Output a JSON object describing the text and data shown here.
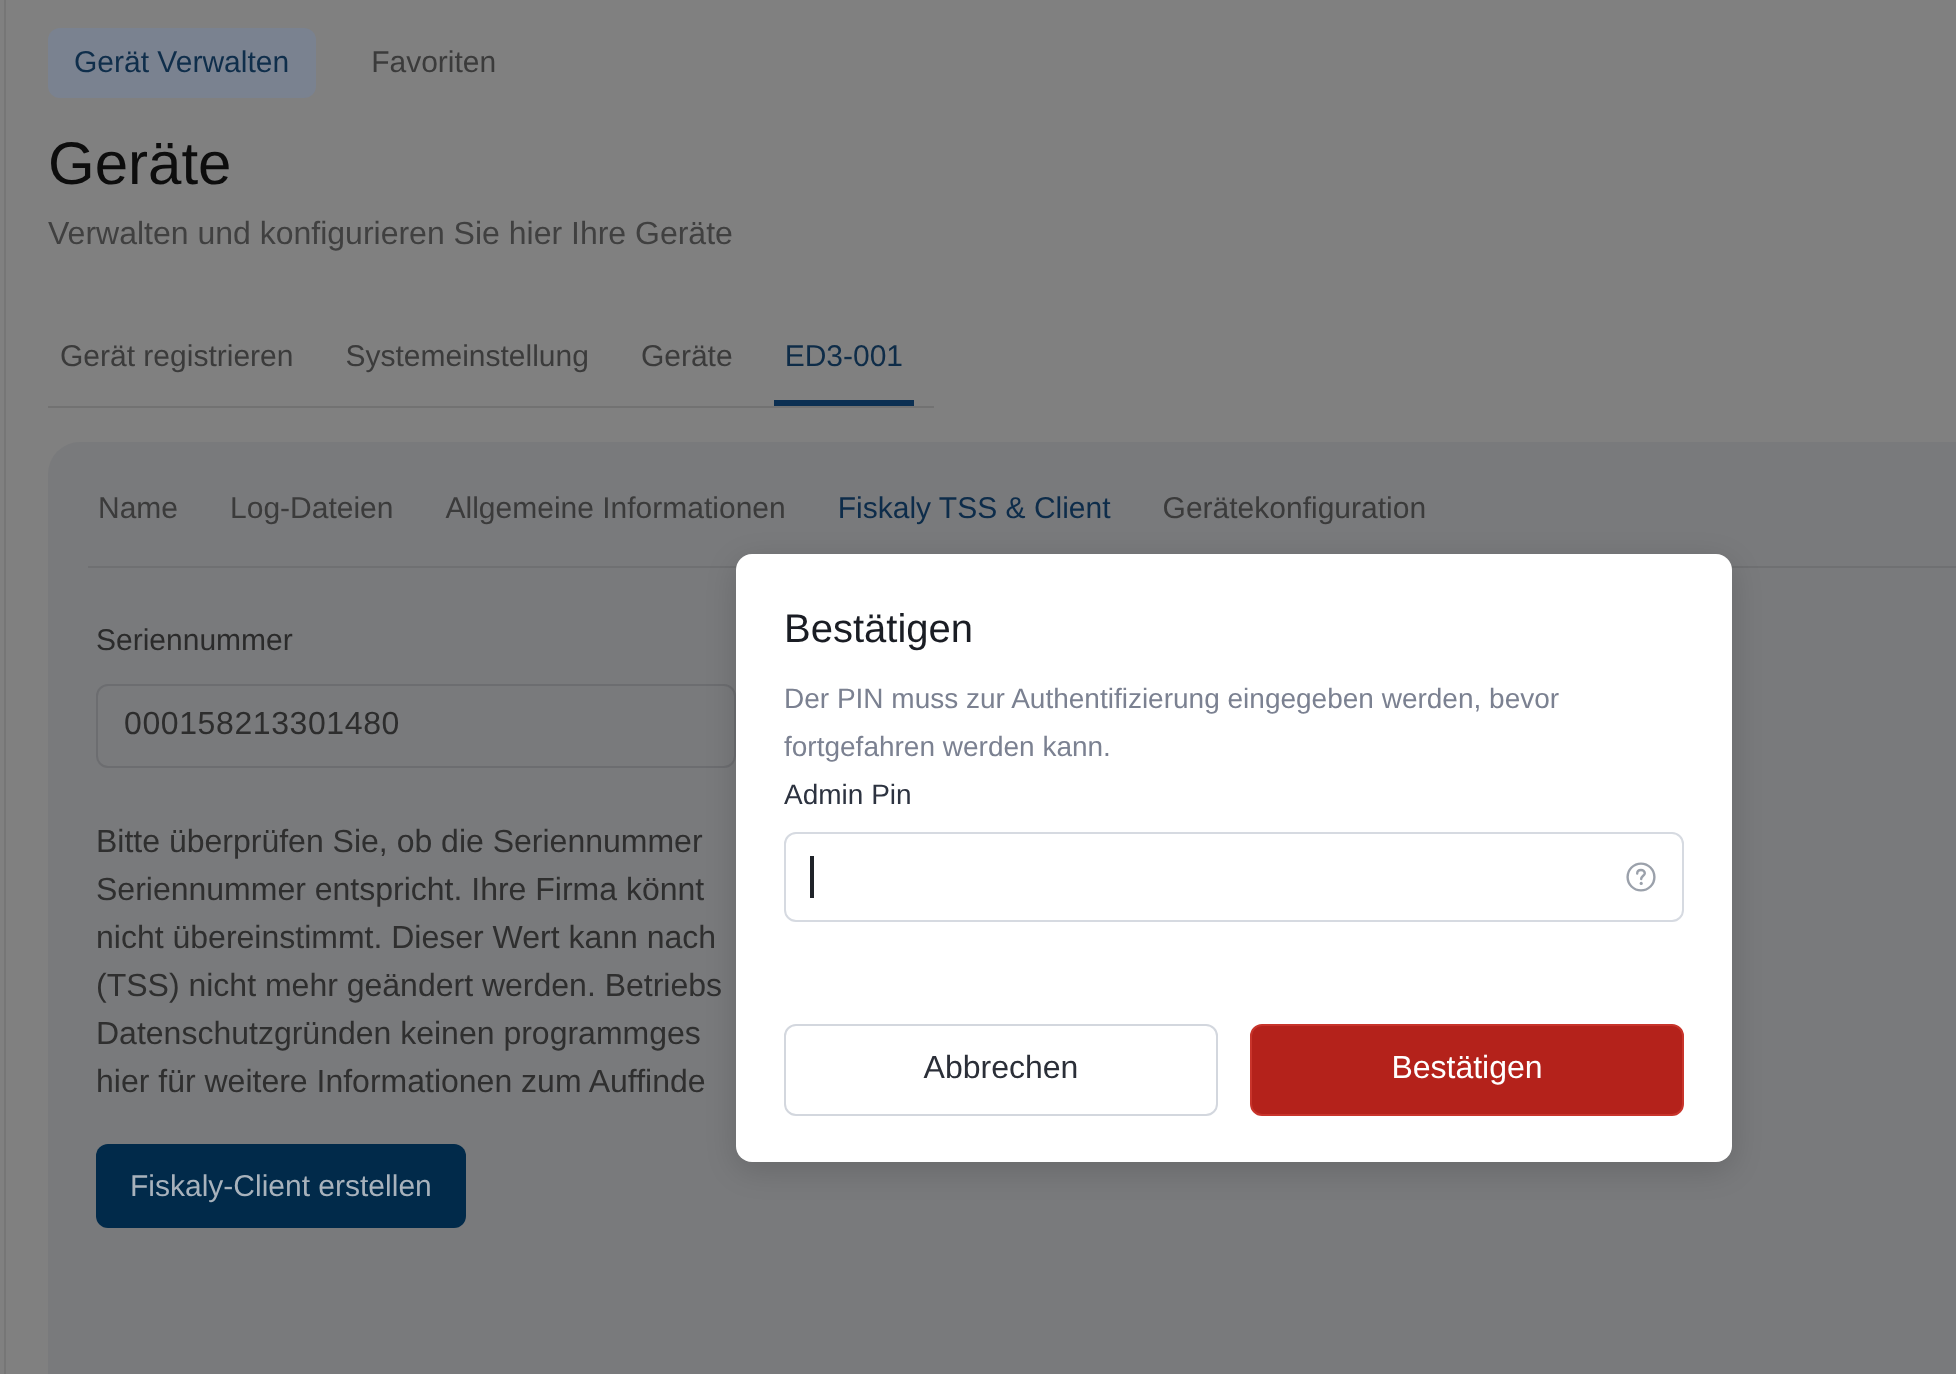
{
  "top_tabs": [
    {
      "label": "Gerät Verwalten",
      "selected": true
    },
    {
      "label": "Favoriten",
      "selected": false
    }
  ],
  "page_header": {
    "title": "Geräte",
    "subtitle": "Verwalten und konfigurieren Sie hier Ihre Geräte"
  },
  "device_tabs": [
    {
      "label": "Gerät registrieren",
      "selected": false
    },
    {
      "label": "Systemeinstellung",
      "selected": false
    },
    {
      "label": "Geräte",
      "selected": false
    },
    {
      "label": "ED3-001",
      "selected": true
    }
  ],
  "detail_panel": {
    "tabs": [
      {
        "label": "Name",
        "selected": false
      },
      {
        "label": "Log-Dateien",
        "selected": false
      },
      {
        "label": "Allgemeine Informationen",
        "selected": false
      },
      {
        "label": "Fiskaly TSS & Client",
        "selected": true
      },
      {
        "label": "Gerätekonfiguration",
        "selected": false
      }
    ],
    "serial_number": {
      "label": "Seriennummer",
      "value": "000158213301480"
    },
    "notice_lines": [
      "Bitte überprüfen Sie, ob die Seriennummer",
      "Seriennummer entspricht. Ihre Firma könnt",
      "nicht übereinstimmt. Dieser Wert kann nach",
      "(TSS) nicht mehr geändert werden. Betriebs",
      "Datenschutzgründen keinen programmges",
      "hier für weitere Informationen zum Auffinde"
    ],
    "create_client_button": "Fiskaly-Client erstellen"
  },
  "dialog": {
    "title": "Bestätigen",
    "description": "Der PIN muss zur Authentifizierung eingegeben werden, bevor fortgefahren werden kann.",
    "pin_field": {
      "label": "Admin Pin",
      "focused": true
    },
    "buttons": [
      {
        "label": "Abbrechen",
        "kind": "secondary"
      },
      {
        "label": "Bestätigen",
        "kind": "primary"
      }
    ]
  }
}
